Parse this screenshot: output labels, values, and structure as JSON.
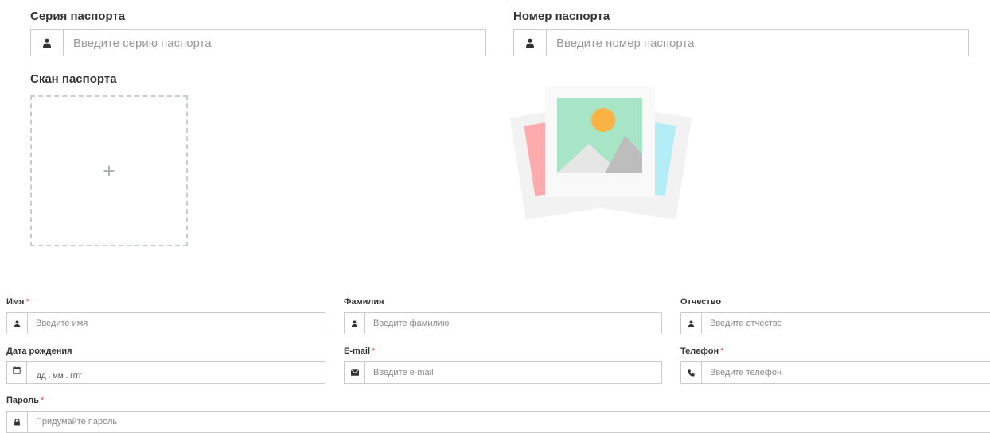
{
  "passport": {
    "series_label": "Серия паспорта",
    "series_placeholder": "Введите серию паспорта",
    "number_label": "Номер паспорта",
    "number_placeholder": "Введите номер паспорта",
    "scan_label": "Скан паспорта",
    "scan_add_symbol": "+"
  },
  "form": {
    "required_mark": "*",
    "first_name": {
      "label": "Имя",
      "placeholder": "Введите имя"
    },
    "last_name": {
      "label": "Фамилия",
      "placeholder": "Введите фамилию"
    },
    "patronymic": {
      "label": "Отчество",
      "placeholder": "Введите отчество"
    },
    "birth_date": {
      "label": "Дата рождения",
      "placeholder": "дд . мм . гггг"
    },
    "email": {
      "label": "E-mail",
      "placeholder": "Введите e-mail"
    },
    "phone": {
      "label": "Телефон",
      "placeholder": "Введите телефон"
    },
    "password": {
      "label": "Пароль",
      "placeholder": "Придумайте пароль"
    }
  },
  "icons": {
    "user": "user-icon",
    "calendar": "calendar-icon",
    "envelope": "envelope-icon",
    "phone": "phone-icon",
    "lock": "lock-icon",
    "image_placeholder": "image-placeholder-icon"
  },
  "colors": {
    "required": "#e04b4b",
    "border": "#cccccc",
    "dashed_border": "#c9ccd1"
  }
}
